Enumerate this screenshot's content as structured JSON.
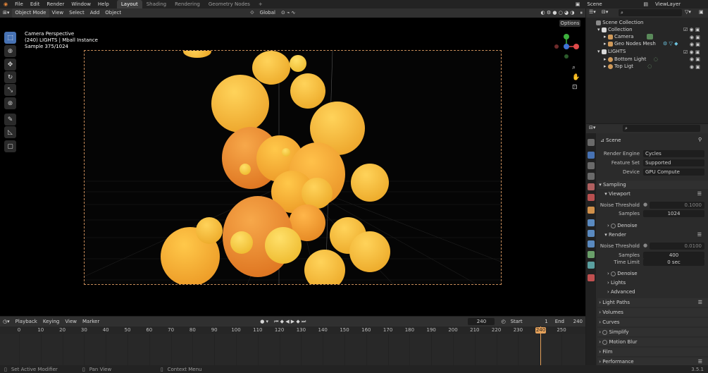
{
  "topbar": {
    "menus": [
      "File",
      "Edit",
      "Render",
      "Window",
      "Help"
    ],
    "workspaces": [
      "Layout",
      "Shading",
      "Rendering",
      "Geometry Nodes"
    ],
    "add": "+",
    "scene": "Scene",
    "viewlayer": "ViewLayer"
  },
  "viewport": {
    "mode": "Object Mode",
    "menus": [
      "View",
      "Select",
      "Add",
      "Object"
    ],
    "transform": "Global",
    "options": "Options",
    "info": {
      "line1": "Camera Perspective",
      "line2": "(240) LIGHTS | Mball Instance",
      "line3": "Sample 375/1024"
    }
  },
  "timeline": {
    "menus": [
      "Playback",
      "Keying",
      "View",
      "Marker"
    ],
    "current": "240",
    "start_label": "Start",
    "start": "1",
    "end_label": "End",
    "end": "240",
    "ticks": [
      "0",
      "10",
      "20",
      "30",
      "40",
      "50",
      "60",
      "70",
      "80",
      "90",
      "100",
      "110",
      "120",
      "130",
      "140",
      "150",
      "160",
      "170",
      "180",
      "190",
      "200",
      "210",
      "220",
      "230",
      "240",
      "250"
    ]
  },
  "status": {
    "left": "Set Active Modifier",
    "mid": "Pan View",
    "right": "Context Menu",
    "version": "3.5.1"
  },
  "outliner": {
    "items": [
      "Scene Collection",
      "Collection",
      "Camera",
      "Geo Nodes Mesh",
      "LIGHTS",
      "Bottom Light",
      "Top Ligt"
    ]
  },
  "properties": {
    "breadcrumb": "Scene",
    "render_engine_label": "Render Engine",
    "render_engine": "Cycles",
    "feature_set_label": "Feature Set",
    "feature_set": "Supported",
    "device_label": "Device",
    "device": "GPU Compute",
    "sampling": "Sampling",
    "viewport": "Viewport",
    "noise_threshold_label": "Noise Threshold",
    "vp_noise": "0.1000",
    "samples_label": "Samples",
    "vp_samples": "1024",
    "denoise": "Denoise",
    "render": "Render",
    "r_noise": "0.0100",
    "r_samples": "400",
    "time_limit_label": "Time Limit",
    "time_limit": "0 sec",
    "lights": "Lights",
    "advanced": "Advanced",
    "sections": [
      "Light Paths",
      "Volumes",
      "Curves",
      "Simplify",
      "Motion Blur",
      "Film",
      "Performance"
    ]
  },
  "colors": {
    "accent": "#4772b3",
    "playhead": "#e5a15a",
    "blob": "#f2b42c"
  }
}
